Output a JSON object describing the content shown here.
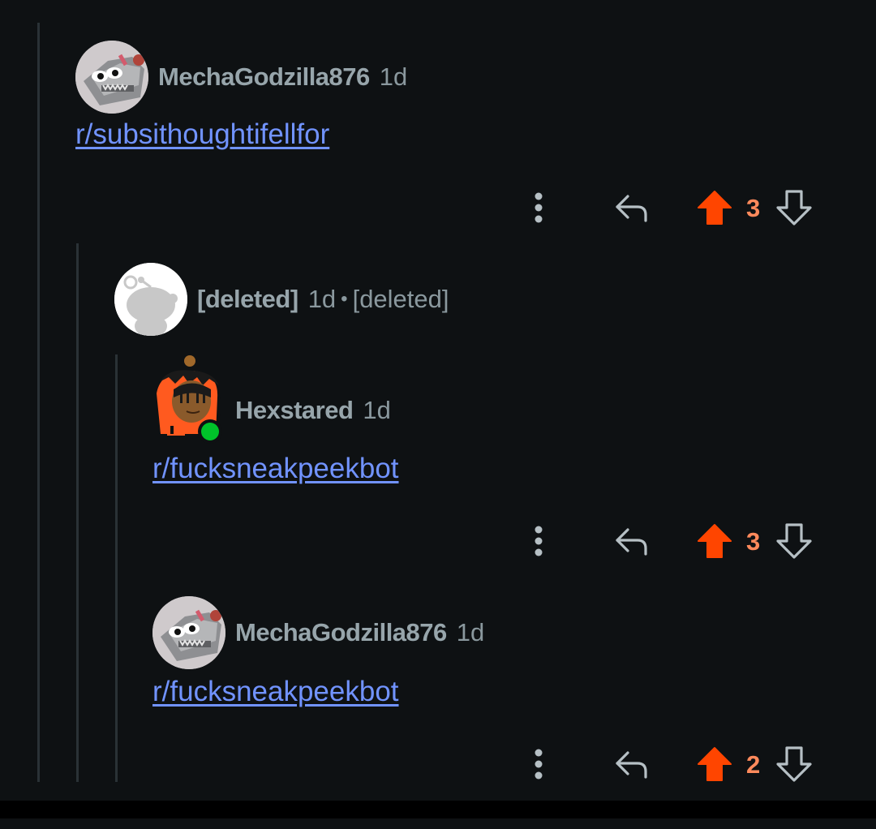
{
  "comments": [
    {
      "username": "MechaGodzilla876",
      "age": "1d",
      "avatar_icon": "mecha-godzilla-avatar",
      "body": "r/subsithoughtifellfor",
      "score": "3"
    },
    {
      "username": "[deleted]",
      "age": "1d",
      "separator": "•",
      "flair": "[deleted]",
      "avatar_icon": "default-snoo-avatar"
    },
    {
      "username": "Hexstared",
      "age": "1d",
      "avatar_icon": "orange-hoodie-avatar",
      "online_status": "online",
      "body": "r/fucksneakpeekbot",
      "score": "3"
    },
    {
      "username": "MechaGodzilla876",
      "age": "1d",
      "avatar_icon": "mecha-godzilla-avatar",
      "body": "r/fucksneakpeekbot",
      "score": "2"
    }
  ],
  "colors": {
    "background": "#0e1113",
    "upvote_active": "#ff4500",
    "score": "#ff8a5c",
    "link": "#7193ff",
    "username": "#97a5ab",
    "thread_line": "#2a3236"
  }
}
